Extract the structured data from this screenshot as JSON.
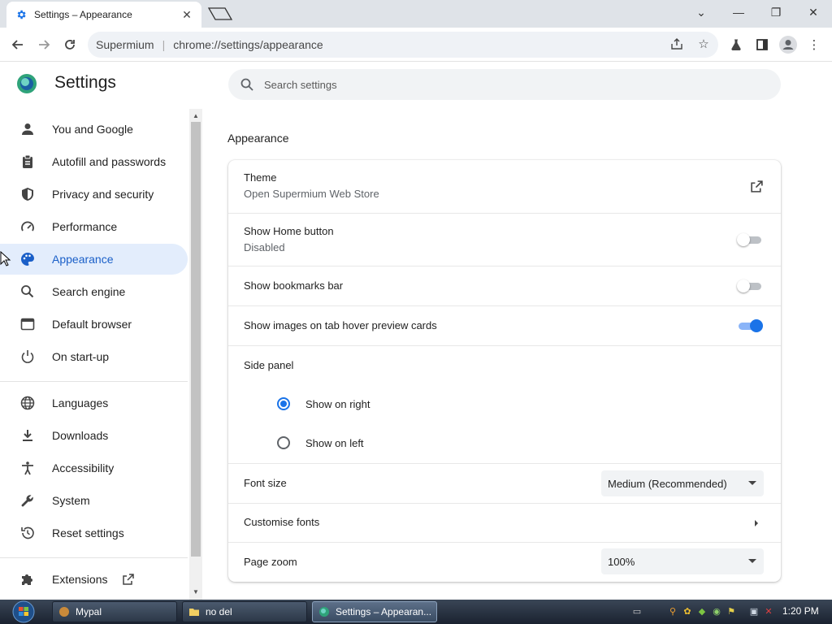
{
  "browser": {
    "tab_title": "Settings – Appearance",
    "omnibox_site": "Supermium",
    "omnibox_url": "chrome://settings/appearance"
  },
  "header": {
    "title": "Settings",
    "search_placeholder": "Search settings"
  },
  "sidebar": {
    "items": [
      {
        "label": "You and Google",
        "icon": "person-icon"
      },
      {
        "label": "Autofill and passwords",
        "icon": "clipboard-icon"
      },
      {
        "label": "Privacy and security",
        "icon": "shield-icon"
      },
      {
        "label": "Performance",
        "icon": "gauge-icon"
      },
      {
        "label": "Appearance",
        "icon": "palette-icon",
        "active": true
      },
      {
        "label": "Search engine",
        "icon": "search-icon"
      },
      {
        "label": "Default browser",
        "icon": "browser-icon"
      },
      {
        "label": "On start-up",
        "icon": "power-icon"
      },
      {
        "label": "Languages",
        "icon": "globe-icon"
      },
      {
        "label": "Downloads",
        "icon": "download-icon"
      },
      {
        "label": "Accessibility",
        "icon": "accessibility-icon"
      },
      {
        "label": "System",
        "icon": "wrench-icon"
      },
      {
        "label": "Reset settings",
        "icon": "reset-icon"
      },
      {
        "label": "Extensions",
        "icon": "puzzle-icon"
      }
    ]
  },
  "main": {
    "section_title": "Appearance",
    "theme": {
      "label": "Theme",
      "sub": "Open Supermium Web Store"
    },
    "home_button": {
      "label": "Show Home button",
      "sub": "Disabled",
      "enabled": false
    },
    "bookmarks_bar": {
      "label": "Show bookmarks bar",
      "enabled": false
    },
    "tab_hover": {
      "label": "Show images on tab hover preview cards",
      "enabled": true
    },
    "side_panel": {
      "label": "Side panel",
      "options": [
        "Show on right",
        "Show on left"
      ],
      "selected": "Show on right"
    },
    "font_size": {
      "label": "Font size",
      "value": "Medium (Recommended)"
    },
    "customise_fonts": {
      "label": "Customise fonts"
    },
    "page_zoom": {
      "label": "Page zoom",
      "value": "100%"
    }
  },
  "taskbar": {
    "tasks": [
      "Mypal",
      "no del",
      "Settings – Appearan..."
    ],
    "clock": "1:20 PM"
  },
  "colors": {
    "accent": "#1a73e8",
    "active_nav_bg": "#e3edfc"
  }
}
